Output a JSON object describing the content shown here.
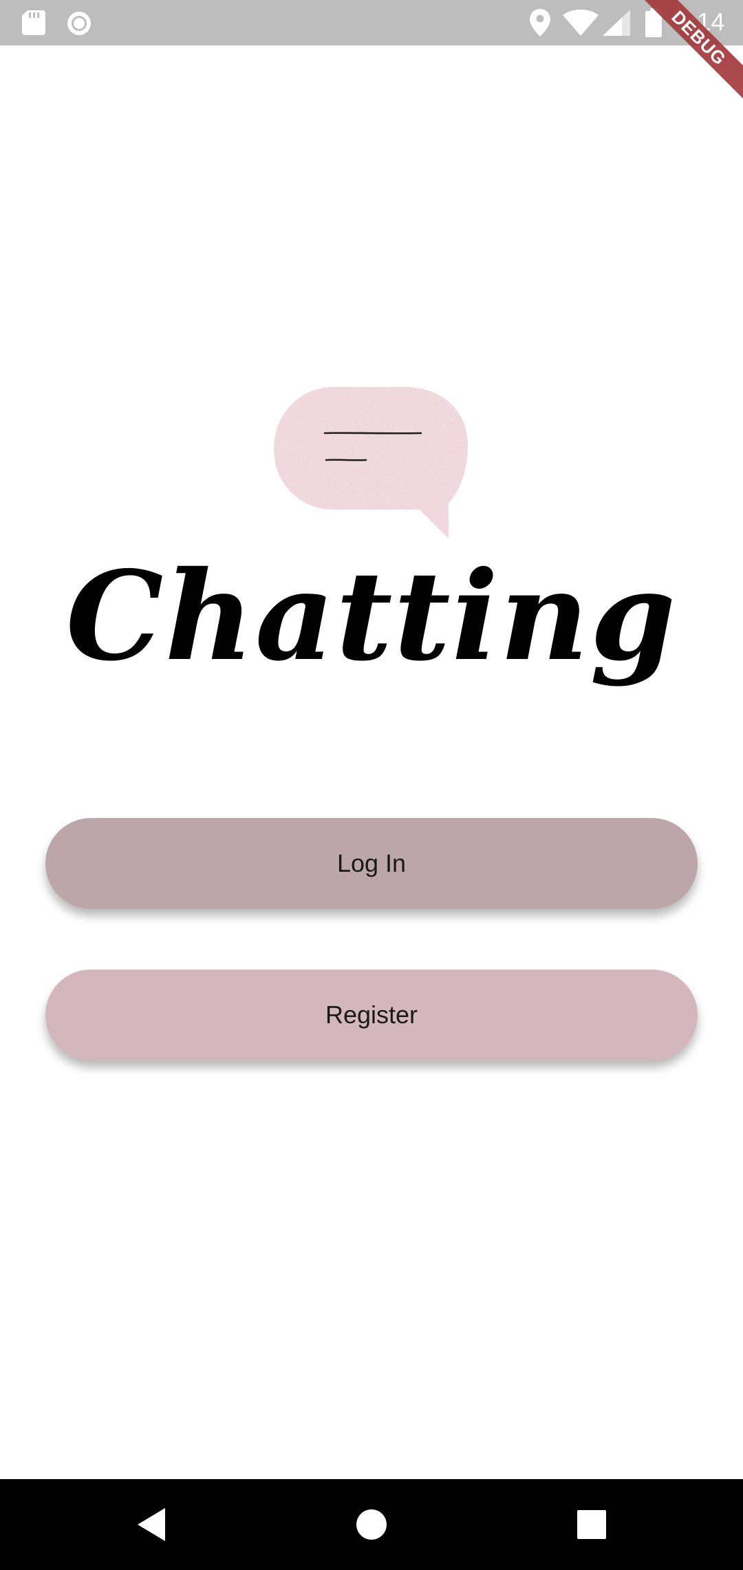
{
  "status_bar": {
    "time": "1:14",
    "icons": [
      "sd-card-icon",
      "record-icon",
      "location-icon",
      "wifi-icon",
      "signal-icon",
      "battery-icon"
    ]
  },
  "debug_banner": {
    "label": "DEBUG",
    "color": "#a33a3e"
  },
  "app": {
    "title": "Chatting",
    "logo_icon": "chat-bubble-icon",
    "logo_color": "#ebcdd5"
  },
  "buttons": {
    "login_label": "Log In",
    "login_color": "#bca6ab",
    "register_label": "Register",
    "register_color": "#d4b6bd"
  },
  "nav_bar": {
    "icons": [
      "back-icon",
      "home-icon",
      "recent-apps-icon"
    ]
  }
}
